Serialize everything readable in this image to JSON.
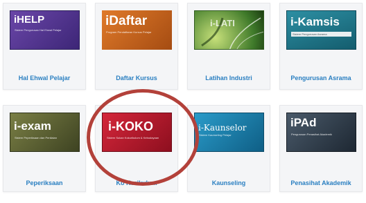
{
  "tiles": [
    {
      "banner_title": "iHELP",
      "banner_sub": "Sistem Pengurusan Hal Ehwal Pelajar",
      "label": "Hal Ehwal Pelajar"
    },
    {
      "banner_title": "iDaftar",
      "banner_sub": "Program Pendaftaran Kursus Pelajar",
      "label": "Daftar Kursus"
    },
    {
      "banner_title": "i-LATI",
      "banner_sub": "",
      "label": "Latihan Industri"
    },
    {
      "banner_title": "i-Kamsis",
      "banner_sub": "Sistem Pengurusan Asrama",
      "label": "Pengurusan Asrama"
    },
    {
      "banner_title": "i-exam",
      "banner_sub": "Sistem Peperiksaan dan Penilaian",
      "label": "Peperiksaan"
    },
    {
      "banner_title": "i-KOKO",
      "banner_sub": "Sistem Sukan Kokurikulum & Kebudayaan",
      "label": "Ko Kurikulum"
    },
    {
      "banner_title": "i-Kaunselor",
      "banner_sub": "Sistem Kaunseling Pelajar",
      "label": "Kaunseling"
    },
    {
      "banner_title": "iPAd",
      "banner_sub": "Pengurusan Penasihat Akademik",
      "label": "Penasihat Akademik"
    }
  ],
  "colors": {
    "label": "#2a7fc1",
    "highlight_circle": "#b3413a"
  }
}
